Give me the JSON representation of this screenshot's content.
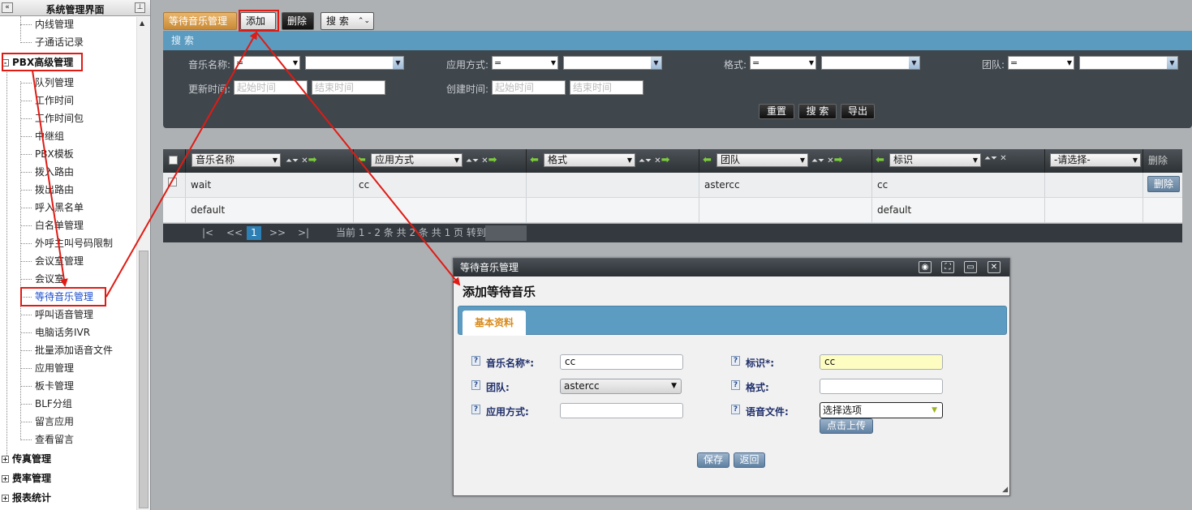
{
  "sidebar": {
    "title": "系统管理界面",
    "collapse_icon": "«",
    "pin_icon": "⊥",
    "items_top": [
      {
        "label": "内线管理"
      },
      {
        "label": "子通话记录"
      }
    ],
    "group_pbx": {
      "box": "-",
      "label": "PBX高级管理"
    },
    "items_pbx": [
      {
        "label": "队列管理"
      },
      {
        "label": "工作时间"
      },
      {
        "label": "工作时间包"
      },
      {
        "label": "中继组"
      },
      {
        "label": "PBX模板"
      },
      {
        "label": "拨入路由"
      },
      {
        "label": "拨出路由"
      },
      {
        "label": "呼入黑名单"
      },
      {
        "label": "白名单管理"
      },
      {
        "label": "外呼主叫号码限制"
      },
      {
        "label": "会议室管理"
      },
      {
        "label": "会议室"
      },
      {
        "label": "等待音乐管理"
      },
      {
        "label": "呼叫语音管理"
      },
      {
        "label": "电脑话务IVR"
      },
      {
        "label": "批量添加语音文件"
      },
      {
        "label": "应用管理"
      },
      {
        "label": "板卡管理"
      },
      {
        "label": "BLF分组"
      },
      {
        "label": "留言应用"
      },
      {
        "label": "查看留言"
      }
    ],
    "groups_bottom": [
      {
        "box": "+",
        "label": "传真管理"
      },
      {
        "box": "+",
        "label": "费率管理"
      },
      {
        "box": "+",
        "label": "报表统计"
      }
    ]
  },
  "toolbar": {
    "tab_label": "等待音乐管理",
    "add_label": "添加",
    "delete_label": "删除",
    "search_label": "搜 索",
    "search_chevron": "⌃⌄"
  },
  "search": {
    "header": "搜 索",
    "music_name_label": "音乐名称:",
    "music_name_op": "=",
    "apply_mode_label": "应用方式:",
    "apply_mode_op": "=",
    "format_label": "格式:",
    "format_op": "=",
    "team_label": "团队:",
    "team_op": "=",
    "update_time_label": "更新时间:",
    "update_start_placeholder": "起始时间",
    "update_end_placeholder": "结束时间",
    "create_time_label": "创建时间:",
    "create_start_placeholder": "起始时间",
    "create_end_placeholder": "结束时间",
    "reset_label": "重置",
    "search_label": "搜 索",
    "export_label": "导出"
  },
  "grid": {
    "columns": [
      "音乐名称",
      "应用方式",
      "格式",
      "团队",
      "标识",
      "-请选择-",
      "删除"
    ],
    "rows": [
      {
        "name": "wait",
        "mode": "cc",
        "format": "",
        "team": "astercc",
        "tag": "cc",
        "delete": "删除"
      },
      {
        "name": "default",
        "mode": "",
        "format": "",
        "team": "",
        "tag": "default",
        "delete": ""
      }
    ],
    "pager": {
      "first": "|<",
      "prev": "<<",
      "current": "1",
      "next": ">>",
      "last": ">|",
      "summary": "当前 1 - 2 条 共 2 条 共 1 页 转到"
    }
  },
  "dialog": {
    "title": "等待音乐管理",
    "heading": "添加等待音乐",
    "tab": "基本资料",
    "fields": {
      "music_name_label": "音乐名称*:",
      "music_name_value": "cc",
      "tag_label": "标识*:",
      "tag_value": "cc",
      "team_label": "团队:",
      "team_value": "astercc",
      "format_label": "格式:",
      "format_value": "",
      "apply_mode_label": "应用方式:",
      "apply_mode_value": "",
      "voice_file_label": "语音文件:",
      "voice_file_value": "选择选项"
    },
    "upload_label": "点击上传",
    "save_label": "保存",
    "back_label": "返回",
    "help_icon": "?"
  },
  "colors": {
    "annotation_red": "#e01b14",
    "panel_dark": "#3f464c",
    "panel_blue": "#5b9bc0",
    "tab_orange": "#d98b1c"
  }
}
